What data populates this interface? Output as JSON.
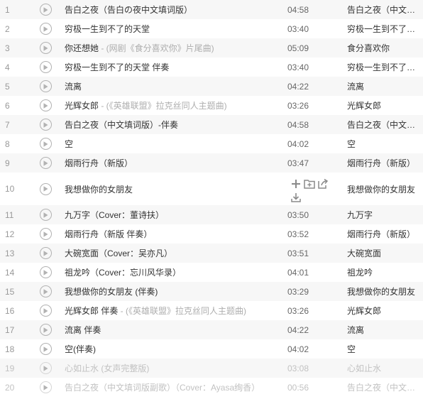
{
  "songs": [
    {
      "index": "1",
      "title": "告白之夜（告白の夜中文填词版）",
      "subtitle": "",
      "duration": "04:58",
      "artist": "告白之夜（中文填词版）",
      "disabled": false
    },
    {
      "index": "2",
      "title": "穷极一生到不了的天堂",
      "subtitle": "",
      "duration": "03:40",
      "artist": "穷极一生到不了的天堂",
      "disabled": false
    },
    {
      "index": "3",
      "title": "你还想她",
      "subtitle": " - (网剧《食分喜欢你》片尾曲)",
      "duration": "05:09",
      "artist": "食分喜欢你",
      "disabled": false
    },
    {
      "index": "4",
      "title": "穷极一生到不了的天堂 伴奏",
      "subtitle": "",
      "duration": "03:40",
      "artist": "穷极一生到不了的天堂",
      "disabled": false
    },
    {
      "index": "5",
      "title": "流离",
      "subtitle": "",
      "duration": "04:22",
      "artist": "流离",
      "disabled": false
    },
    {
      "index": "6",
      "title": "光辉女郎",
      "subtitle": " - (《英雄联盟》拉克丝同人主题曲)",
      "duration": "03:26",
      "artist": "光辉女郎",
      "disabled": false
    },
    {
      "index": "7",
      "title": "告白之夜（中文填词版）-伴奏",
      "subtitle": "",
      "duration": "04:58",
      "artist": "告白之夜（中文填词版）",
      "disabled": false
    },
    {
      "index": "8",
      "title": "空",
      "subtitle": "",
      "duration": "04:02",
      "artist": "空",
      "disabled": false
    },
    {
      "index": "9",
      "title": "烟雨行舟（新版）",
      "subtitle": "",
      "duration": "03:47",
      "artist": "烟雨行舟（新版）",
      "disabled": false
    },
    {
      "index": "10",
      "title": "我想做你的女朋友",
      "subtitle": "",
      "duration": "",
      "artist": "我想做你的女朋友",
      "disabled": false,
      "hover": true
    },
    {
      "index": "11",
      "title": "九万字（Cover：董诗扶）",
      "subtitle": "",
      "duration": "03:50",
      "artist": "九万字",
      "disabled": false
    },
    {
      "index": "12",
      "title": "烟雨行舟（新版 伴奏）",
      "subtitle": "",
      "duration": "03:52",
      "artist": "烟雨行舟（新版）",
      "disabled": false
    },
    {
      "index": "13",
      "title": "大碗宽面（Cover：吴亦凡）",
      "subtitle": "",
      "duration": "03:51",
      "artist": "大碗宽面",
      "disabled": false
    },
    {
      "index": "14",
      "title": "祖龙吟（Cover：忘川风华录）",
      "subtitle": "",
      "duration": "04:01",
      "artist": "祖龙吟",
      "disabled": false
    },
    {
      "index": "15",
      "title": "我想做你的女朋友 (伴奏)",
      "subtitle": "",
      "duration": "03:29",
      "artist": "我想做你的女朋友",
      "disabled": false
    },
    {
      "index": "16",
      "title": "光辉女郎 伴奏",
      "subtitle": " - (《英雄联盟》拉克丝同人主题曲)",
      "duration": "03:26",
      "artist": "光辉女郎",
      "disabled": false
    },
    {
      "index": "17",
      "title": "流离 伴奏",
      "subtitle": "",
      "duration": "04:22",
      "artist": "流离",
      "disabled": false
    },
    {
      "index": "18",
      "title": "空(伴奏)",
      "subtitle": "",
      "duration": "04:02",
      "artist": "空",
      "disabled": false
    },
    {
      "index": "19",
      "title": "心如止水 (女声完整版)",
      "subtitle": "",
      "duration": "03:08",
      "artist": "心如止水",
      "disabled": true
    },
    {
      "index": "20",
      "title": "告白之夜（中文填词版副歌）（Cover：Ayasa绚香）",
      "subtitle": "",
      "duration": "00:56",
      "artist": "告白之夜（中文填词版）",
      "disabled": true
    }
  ],
  "row_actions": [
    "add-icon",
    "add-to-folder-icon",
    "share-icon",
    "download-icon"
  ],
  "colors": {
    "stripe": "#f7f7f7",
    "text": "#333333",
    "muted": "#aeaeae",
    "disabled": "#c2c2c2"
  }
}
